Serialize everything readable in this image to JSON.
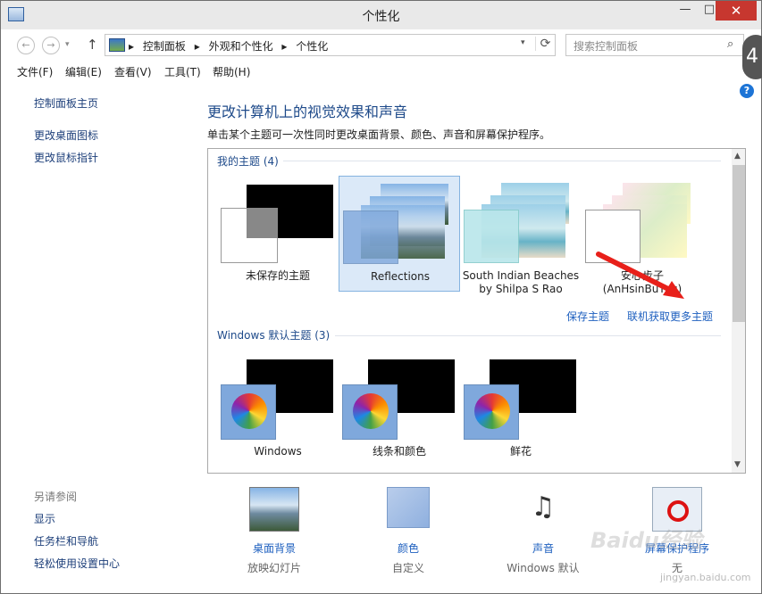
{
  "window": {
    "title": "个性化",
    "min": "—",
    "max": "□",
    "close": "✕"
  },
  "nav": {
    "back": "←",
    "forward": "→",
    "recent": "▾",
    "up": "↑",
    "breadcrumb": [
      "控制面板",
      "▸",
      "外观和个性化",
      "▸",
      "个性化"
    ],
    "breadcrumb_lead": "▸",
    "dropdown": "▾",
    "refresh": "⟳",
    "search_placeholder": "搜索控制面板",
    "search_icon": "⌕"
  },
  "menu": [
    "文件(F)",
    "编辑(E)",
    "查看(V)",
    "工具(T)",
    "帮助(H)"
  ],
  "help": "?",
  "sidebar": {
    "links": [
      "控制面板主页",
      "更改桌面图标",
      "更改鼠标指针"
    ],
    "see_also_title": "另请参阅",
    "see_also": [
      "显示",
      "任务栏和导航",
      "轻松使用设置中心"
    ]
  },
  "main": {
    "heading": "更改计算机上的视觉效果和声音",
    "description": "单击某个主题可一次性同时更改桌面背景、颜色、声音和屏幕保护程序。"
  },
  "my_themes": {
    "title": "我的主题 (4)",
    "themes": [
      {
        "name": "未保存的主题"
      },
      {
        "name": "Reflections"
      },
      {
        "name": "South Indian Beaches",
        "name2": "by Shilpa S Rao"
      },
      {
        "name": "安心步子",
        "name2": "(AnHsinBuTzu)"
      }
    ],
    "save_link": "保存主题",
    "more_link": "联机获取更多主题"
  },
  "default_themes": {
    "title": "Windows 默认主题 (3)",
    "themes": [
      {
        "name": "Windows"
      },
      {
        "name": "线条和颜色"
      },
      {
        "name": "鲜花"
      }
    ]
  },
  "bottom": [
    {
      "link": "桌面背景",
      "sub": "放映幻灯片"
    },
    {
      "link": "颜色",
      "sub": "自定义"
    },
    {
      "link": "声音",
      "sub": "Windows 默认"
    },
    {
      "link": "屏幕保护程序",
      "sub": "无"
    }
  ],
  "overlay": {
    "badge": "4",
    "watermark": "Baidu经验",
    "watermark_sub": "jingyan.baidu.com"
  },
  "colors": {
    "accent": "#1d5fbf",
    "close": "#c7372f",
    "arrow": "#e8201a"
  }
}
